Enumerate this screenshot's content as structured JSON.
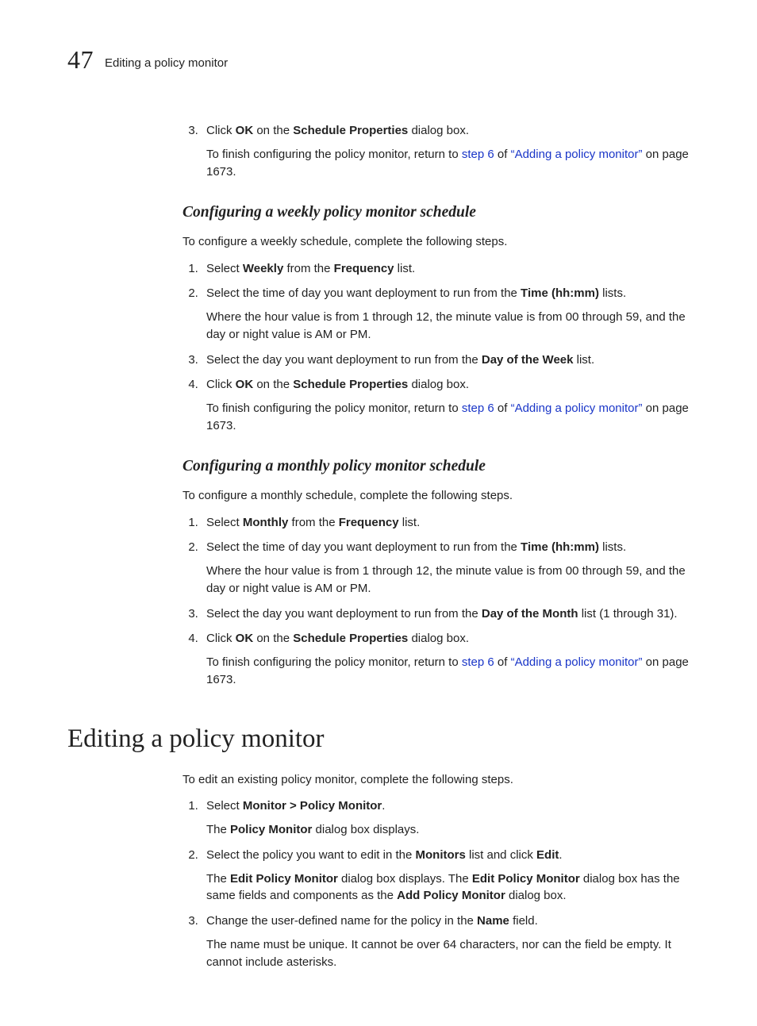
{
  "header": {
    "chapter_number": "47",
    "chapter_title": "Editing a policy monitor"
  },
  "sections": {
    "step3_prefix": "Click ",
    "step3_ok": "OK",
    "step3_on_the": " on the ",
    "step3_dialog": "Schedule Properties",
    "step3_suffix": " dialog box.",
    "finish_prefix": "To finish configuring the policy monitor, return to ",
    "finish_step6": "step 6",
    "finish_of": " of ",
    "finish_link": "“Adding a policy monitor”",
    "finish_on": " on page 1673.",
    "weekly_heading": "Configuring a weekly policy monitor schedule",
    "weekly_intro": "To configure a weekly schedule, complete the following steps.",
    "weekly_s1_a": "Select ",
    "weekly_s1_b": "Weekly",
    "weekly_s1_c": " from the ",
    "weekly_s1_d": "Frequency",
    "weekly_s1_e": " list.",
    "weekly_s2_a": "Select the time of day you want deployment to run from the ",
    "weekly_s2_b": "Time (hh:mm)",
    "weekly_s2_c": " lists.",
    "weekly_s2_sub": "Where the hour value is from 1 through 12, the minute value is from 00 through 59, and the day or night value is AM or PM.",
    "weekly_s3_a": "Select the day you want deployment to run from the ",
    "weekly_s3_b": "Day of the Week",
    "weekly_s3_c": " list.",
    "monthly_heading": "Configuring a monthly policy monitor schedule",
    "monthly_intro": "To configure a monthly schedule, complete the following steps.",
    "monthly_s1_a": "Select ",
    "monthly_s1_b": "Monthly",
    "monthly_s1_c": " from the ",
    "monthly_s1_d": "Frequency",
    "monthly_s1_e": " list.",
    "monthly_s3_a": "Select the day you want deployment to run from the ",
    "monthly_s3_b": "Day of the Month",
    "monthly_s3_c": " list (1 through 31).",
    "edit_heading": "Editing a policy monitor",
    "edit_intro": "To edit an existing policy monitor, complete the following steps.",
    "edit_s1_a": "Select ",
    "edit_s1_b": "Monitor > Policy Monitor",
    "edit_s1_c": ".",
    "edit_s1_sub_a": "The ",
    "edit_s1_sub_b": "Policy Monitor",
    "edit_s1_sub_c": " dialog box displays.",
    "edit_s2_a": "Select the policy you want to edit in the ",
    "edit_s2_b": "Monitors",
    "edit_s2_c": " list and click ",
    "edit_s2_d": "Edit",
    "edit_s2_e": ".",
    "edit_s2_sub_a": "The ",
    "edit_s2_sub_b": "Edit Policy Monitor",
    "edit_s2_sub_c": " dialog box displays. The ",
    "edit_s2_sub_d": "Edit Policy Monitor",
    "edit_s2_sub_e": " dialog box has the same fields and components as the ",
    "edit_s2_sub_f": "Add Policy Monitor",
    "edit_s2_sub_g": " dialog box.",
    "edit_s3_a": "Change the user-defined name for the policy in the ",
    "edit_s3_b": "Name",
    "edit_s3_c": " field.",
    "edit_s3_sub": "The name must be unique. It cannot be over 64 characters, nor can the field be empty. It cannot include asterisks."
  }
}
